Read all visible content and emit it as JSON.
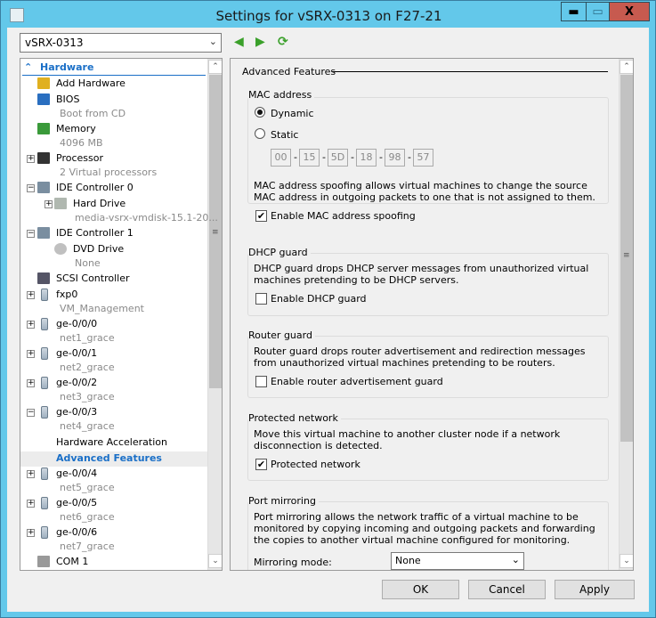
{
  "window": {
    "title": "Settings for vSRX-0313 on F27-21",
    "minimize": "▬",
    "maximize": "▭",
    "close": "X"
  },
  "vm_selector": {
    "value": "vSRX-0313"
  },
  "tree": {
    "section": "Hardware",
    "items": [
      {
        "label": "Add Hardware"
      },
      {
        "label": "BIOS",
        "sub": "Boot from CD"
      },
      {
        "label": "Memory",
        "sub": "4096 MB"
      },
      {
        "label": "Processor",
        "sub": "2 Virtual processors"
      },
      {
        "label": "IDE Controller 0"
      },
      {
        "label": "Hard Drive",
        "sub": "media-vsrx-vmdisk-15.1-20..."
      },
      {
        "label": "IDE Controller 1"
      },
      {
        "label": "DVD Drive",
        "sub": "None"
      },
      {
        "label": "SCSI Controller"
      },
      {
        "label": "fxp0",
        "sub": "VM_Management"
      },
      {
        "label": "ge-0/0/0",
        "sub": "net1_grace"
      },
      {
        "label": "ge-0/0/1",
        "sub": "net2_grace"
      },
      {
        "label": "ge-0/0/2",
        "sub": "net3_grace"
      },
      {
        "label": "ge-0/0/3",
        "sub": "net4_grace"
      },
      {
        "label": "Hardware Acceleration"
      },
      {
        "label": "Advanced Features"
      },
      {
        "label": "ge-0/0/4",
        "sub": "net5_grace"
      },
      {
        "label": "ge-0/0/5",
        "sub": "net6_grace"
      },
      {
        "label": "ge-0/0/6",
        "sub": "net7_grace"
      },
      {
        "label": "COM 1"
      }
    ]
  },
  "panel": {
    "heading": "Advanced Features",
    "mac": {
      "label": "MAC address",
      "dynamic": "Dynamic",
      "static": "Static",
      "selected": "Dynamic",
      "octets": [
        "00",
        "15",
        "5D",
        "18",
        "98",
        "57"
      ],
      "sep": "-",
      "desc": "MAC address spoofing allows virtual machines to change the source MAC address in outgoing packets to one that is not assigned to them.",
      "spoof_label": "Enable MAC address spoofing",
      "spoof_checked": true
    },
    "dhcp": {
      "label": "DHCP guard",
      "desc": "DHCP guard drops DHCP server messages from unauthorized virtual machines pretending to be DHCP servers.",
      "check_label": "Enable DHCP guard",
      "checked": false
    },
    "router": {
      "label": "Router guard",
      "desc": "Router guard drops router advertisement and redirection messages from unauthorized virtual machines pretending to be routers.",
      "check_label": "Enable router advertisement guard",
      "checked": false
    },
    "protected": {
      "label": "Protected network",
      "desc": "Move this virtual machine to another cluster node if a network disconnection is detected.",
      "check_label": "Protected network",
      "checked": true
    },
    "mirror": {
      "label": "Port mirroring",
      "desc": "Port mirroring allows the network traffic of a virtual machine to be monitored by copying incoming and outgoing packets and forwarding the copies to another virtual machine configured for monitoring.",
      "mode_label": "Mirroring mode:",
      "mode_value": "None"
    }
  },
  "buttons": {
    "ok": "OK",
    "cancel": "Cancel",
    "apply": "Apply"
  }
}
